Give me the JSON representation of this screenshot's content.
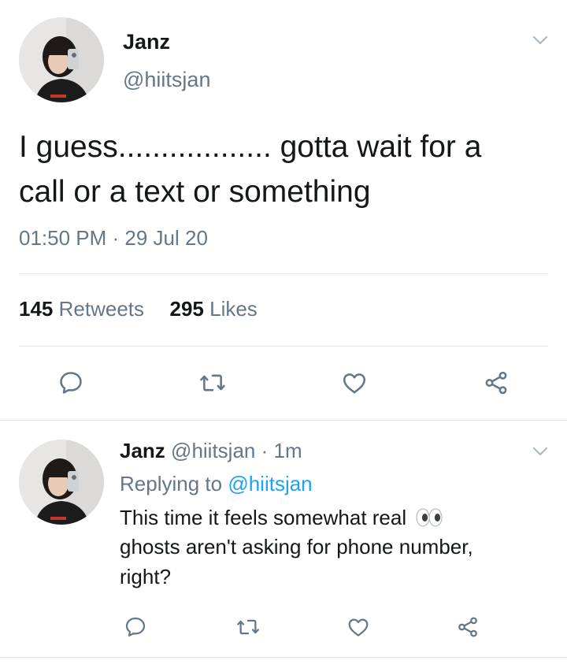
{
  "main_tweet": {
    "author_name": "Janz",
    "author_handle": "@hiitsjan",
    "text_line1": "I guess.................. gotta wait for a",
    "text_line2": "call or a text or something",
    "timestamp": "01:50 PM · 29 Jul 20",
    "retweets_count": "145",
    "retweets_label": "Retweets",
    "likes_count": "295",
    "likes_label": "Likes"
  },
  "reply_tweet": {
    "author_name": "Janz",
    "author_meta": "@hiitsjan · 1m",
    "replying_prefix": "Replying to",
    "replying_handle": "@hiitsjan",
    "text_line1": "This time it feels somewhat real",
    "emoji": "eyes-emoji",
    "text_line2": "ghosts aren't asking for phone number,",
    "text_line3": "right?"
  },
  "icons": [
    "chevron-down-icon",
    "reply-icon",
    "retweet-icon",
    "like-icon",
    "share-icon"
  ],
  "colors": {
    "text": "#14171a",
    "muted": "#657786",
    "link": "#1da1f2",
    "divider": "#e1e8ed"
  }
}
